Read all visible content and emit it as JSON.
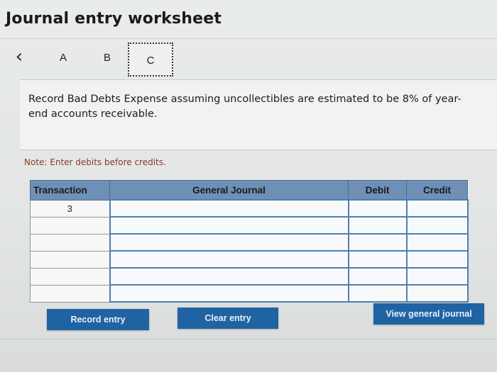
{
  "title": "Journal entry worksheet",
  "nav": {
    "back_icon": "chevron-left-icon",
    "tabs": [
      "A",
      "B",
      "C"
    ],
    "active_tab": "C"
  },
  "instruction": "Record Bad Debts Expense assuming uncollectibles are estimated to be 8% of year-end accounts receivable.",
  "note": "Note: Enter debits before credits.",
  "table": {
    "headers": [
      "Transaction",
      "General Journal",
      "Debit",
      "Credit"
    ],
    "rows": [
      {
        "transaction": "3",
        "account": "",
        "debit": "",
        "credit": ""
      },
      {
        "transaction": "",
        "account": "",
        "debit": "",
        "credit": ""
      },
      {
        "transaction": "",
        "account": "",
        "debit": "",
        "credit": ""
      },
      {
        "transaction": "",
        "account": "",
        "debit": "",
        "credit": ""
      },
      {
        "transaction": "",
        "account": "",
        "debit": "",
        "credit": ""
      },
      {
        "transaction": "",
        "account": "",
        "debit": "",
        "credit": ""
      }
    ]
  },
  "buttons": {
    "record": "Record entry",
    "clear": "Clear entry",
    "view": "View general journal"
  },
  "colors": {
    "header_bg": "#6e8fb6",
    "button_bg": "#1f63a3",
    "note_text": "#8a3a2a"
  }
}
